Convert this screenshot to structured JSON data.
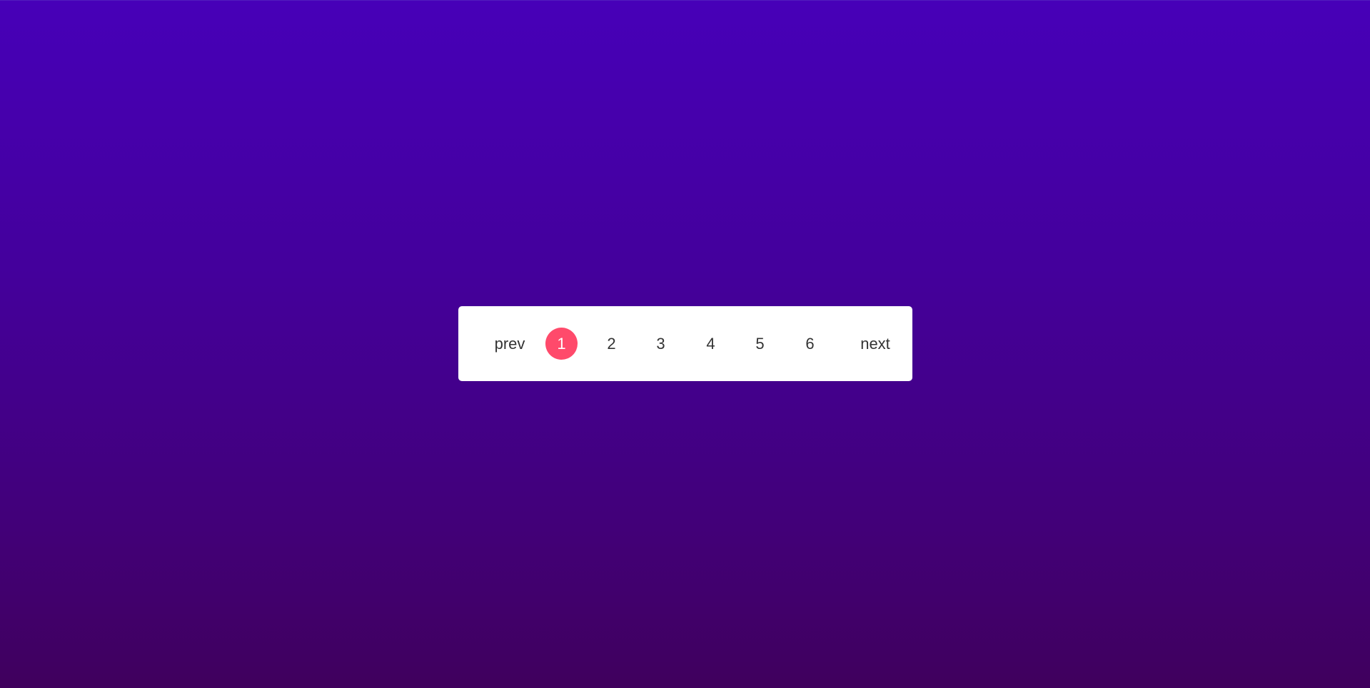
{
  "theme": {
    "accent": "#ff4a6b",
    "background_top": "#4700b8",
    "background_bottom": "#40005d",
    "panel": "#ffffff",
    "text": "#333333"
  },
  "pagination": {
    "prev_label": "prev",
    "next_label": "next",
    "current_page": 1,
    "pages": [
      {
        "label": "1",
        "active": true
      },
      {
        "label": "2",
        "active": false
      },
      {
        "label": "3",
        "active": false
      },
      {
        "label": "4",
        "active": false
      },
      {
        "label": "5",
        "active": false
      },
      {
        "label": "6",
        "active": false
      }
    ]
  }
}
